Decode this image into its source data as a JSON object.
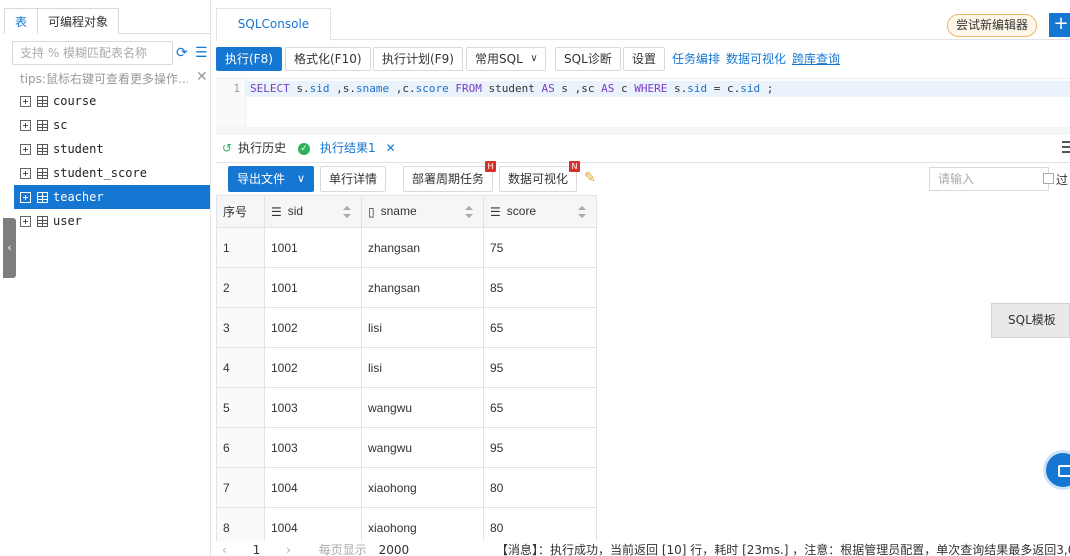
{
  "left": {
    "tabs": [
      "表",
      "可编程对象"
    ],
    "search_placeholder": "支持 % 模糊匹配表名称",
    "tips": "tips:鼠标右键可查看更多操作…",
    "tables": [
      "course",
      "sc",
      "student",
      "student_score",
      "teacher",
      "user"
    ],
    "selected": "teacher"
  },
  "topbar": {
    "tab_label": "SQLConsole",
    "try_new_editor": "尝试新编辑器",
    "plus": "+"
  },
  "toolbar": {
    "run": "执行(F8)",
    "format": "格式化(F10)",
    "plan": "执行计划(F9)",
    "common_sql": "常用SQL",
    "diagnose": "SQL诊断",
    "settings": "设置",
    "task_orchestration": "任务编排",
    "data_visualization": "数据可视化",
    "cross_db_query": "跨库查询"
  },
  "editor": {
    "line_number": "1"
  },
  "result_tabs": {
    "history": "执行历史",
    "result": "执行结果1"
  },
  "result_toolbar": {
    "export": "导出文件",
    "row_detail": "单行详情",
    "deploy_task": "部署周期任务",
    "deploy_badge": "H",
    "visualize": "数据可视化",
    "visualize_badge": "N",
    "search_placeholder": "请输入",
    "filter_label": "过"
  },
  "table": {
    "columns": [
      "序号",
      "sid",
      "sname",
      "score"
    ],
    "rows": [
      [
        "1",
        "1001",
        "zhangsan",
        "75"
      ],
      [
        "2",
        "1001",
        "zhangsan",
        "85"
      ],
      [
        "3",
        "1002",
        "lisi",
        "65"
      ],
      [
        "4",
        "1002",
        "lisi",
        "95"
      ],
      [
        "5",
        "1003",
        "wangwu",
        "65"
      ],
      [
        "6",
        "1003",
        "wangwu",
        "95"
      ],
      [
        "7",
        "1004",
        "xiaohong",
        "80"
      ],
      [
        "8",
        "1004",
        "xiaohong",
        "80"
      ]
    ]
  },
  "sql_template": "SQL模板",
  "status": {
    "pager_page": "1",
    "pager_show": "每页显示",
    "pager_size": "2000",
    "message": "【消息】：执行成功，当前返回 [10] 行，耗时 [23ms.] ，注意：根据管理员配置，单次查询结果最多返回3,0"
  },
  "colors": {
    "accent": "#1677d2",
    "badge": "#d6322b",
    "success": "#2db15a"
  }
}
